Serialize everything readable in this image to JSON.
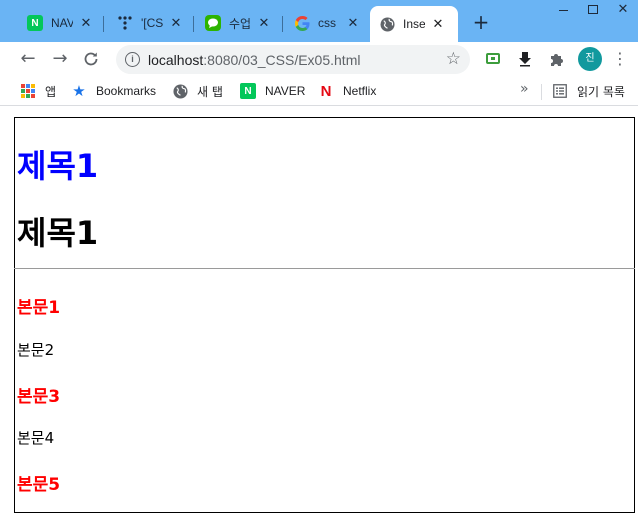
{
  "window": {
    "controls": {
      "close": "✕"
    }
  },
  "tabs": [
    {
      "title": "NAVER",
      "favicon_label": "N",
      "favicon_color": "#03c75a"
    },
    {
      "title": "'[CSS",
      "favicon_label": "",
      "favicon_color": "#1b2a3c"
    },
    {
      "title": "수업",
      "favicon_label": "",
      "favicon_color": "#2db400"
    },
    {
      "title": "css",
      "favicon_label": "G",
      "favicon_color": "#ffffff"
    },
    {
      "title": "Inser",
      "favicon_label": "",
      "favicon_color": "#5f6368"
    }
  ],
  "new_tab_label": "+",
  "toolbar": {
    "url_host": "localhost",
    "url_path": ":8080/03_CSS/Ex05.html",
    "avatar_text": "진"
  },
  "bookmarks": {
    "items": [
      {
        "label": "앱",
        "icon": "apps-grid-icon"
      },
      {
        "label": "Bookmarks",
        "icon": "star-icon"
      },
      {
        "label": "새 탭",
        "icon": "globe-icon"
      },
      {
        "label": "NAVER",
        "icon": "naver-icon"
      },
      {
        "label": "Netflix",
        "icon": "netflix-icon"
      }
    ],
    "overflow": "»",
    "reading_list": "읽기 목록"
  },
  "content": {
    "headings": [
      "제목1",
      "제목1"
    ],
    "paragraphs": [
      "본문1",
      "본문2",
      "본문3",
      "본문4",
      "본문5"
    ]
  },
  "colors": {
    "tabstrip": "#6ab4f4",
    "heading_blue": "#0000ff",
    "text_red": "#ff0000"
  }
}
